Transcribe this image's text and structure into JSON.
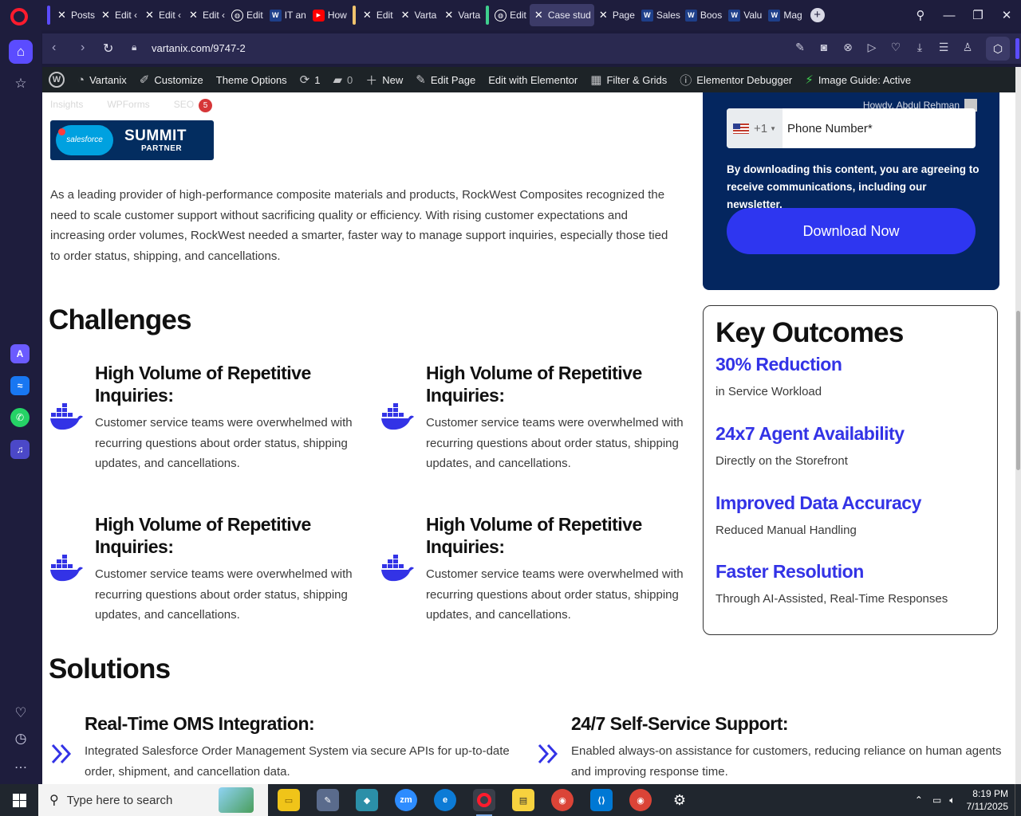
{
  "browser": {
    "tabs": [
      {
        "icon": "x-icon",
        "label": "Posts",
        "group_color": "#5b4cff"
      },
      {
        "icon": "x-icon",
        "label": "Edit ‹"
      },
      {
        "icon": "x-icon",
        "label": "Edit ‹"
      },
      {
        "icon": "x-icon",
        "label": "Edit ‹"
      },
      {
        "icon": "globe-icon",
        "label": "Edit"
      },
      {
        "icon": "wp-icon",
        "label": "IT an"
      },
      {
        "icon": "youtube-icon",
        "label": "How"
      },
      {
        "icon": "x-icon",
        "label": "Edit",
        "group_color": "#f0c36d"
      },
      {
        "icon": "x-icon",
        "label": "Varta"
      },
      {
        "icon": "x-icon",
        "label": "Varta"
      },
      {
        "icon": "globe-icon",
        "label": "Edit",
        "group_color": "#3fcf8e"
      },
      {
        "icon": "x-icon",
        "label": "Case stud",
        "active": true
      },
      {
        "icon": "x-icon",
        "label": "Page"
      },
      {
        "icon": "wp-icon",
        "label": "Sales"
      },
      {
        "icon": "wp-icon",
        "label": "Boos"
      },
      {
        "icon": "wp-icon",
        "label": "Valu"
      },
      {
        "icon": "wp-icon",
        "label": "Mag"
      }
    ],
    "url": "vartanix.com/9747-2"
  },
  "wp_admin_bar": {
    "site_name": "Vartanix",
    "customize": "Customize",
    "theme_options": "Theme Options",
    "updates_count": "1",
    "comments_count": "0",
    "new": "New",
    "edit_page": "Edit Page",
    "edit_elementor": "Edit with Elementor",
    "filter_grids": "Filter & Grids",
    "elementor_debugger": "Elementor Debugger",
    "image_guide": "Image Guide: Active",
    "insights": "Insights",
    "wpforms": "WPForms",
    "seo": "SEO",
    "seo_badge": "5",
    "howdy": "Howdy, Abdul Rehman"
  },
  "partner_badge": {
    "brand": "salesforce",
    "title": "SUMMIT",
    "subtitle": "PARTNER"
  },
  "intro_text": "As a leading provider of high-performance composite materials and products, RockWest Composites recognized the need to scale customer support without sacrificing quality or efficiency. With rising customer expectations and increasing order volumes, RockWest needed a smarter, faster way to manage support inquiries, especially those tied to order status, shipping, and cancellations.",
  "challenges": {
    "heading": "Challenges",
    "items": [
      {
        "title": "High Volume of Repetitive Inquiries:",
        "body": "Customer service teams were overwhelmed with recurring questions about order status, shipping updates, and cancellations."
      },
      {
        "title": "High Volume of Repetitive Inquiries:",
        "body": "Customer service teams were overwhelmed with recurring questions about order status, shipping updates, and cancellations."
      },
      {
        "title": "High Volume of Repetitive Inquiries:",
        "body": "Customer service teams were overwhelmed with recurring questions about order status, shipping updates, and cancellations."
      },
      {
        "title": "High Volume of Repetitive Inquiries:",
        "body": "Customer service teams were overwhelmed with recurring questions about order status, shipping updates, and cancellations."
      }
    ]
  },
  "solutions": {
    "heading": "Solutions",
    "items": [
      {
        "title": "Real-Time OMS Integration:",
        "body": "Integrated Salesforce Order Management System via secure APIs for up-to-date order, shipment, and cancellation data."
      },
      {
        "title": "24/7 Self-Service Support:",
        "body": "Enabled always-on assistance for customers, reducing reliance on human agents and improving response time."
      }
    ]
  },
  "form": {
    "country_code": "+1",
    "phone_placeholder": "Phone Number*",
    "consent": "By downloading this content, you are agreeing to receive communications, including our newsletter.",
    "download_label": "Download Now"
  },
  "key_outcomes": {
    "heading": "Key Outcomes",
    "items": [
      {
        "title": "30% Reduction",
        "subtitle": "in Service Workload"
      },
      {
        "title": "24x7 Agent Availability",
        "subtitle": "Directly on the Storefront"
      },
      {
        "title": "Improved Data Accuracy",
        "subtitle": "Reduced Manual Handling"
      },
      {
        "title": "Faster Resolution",
        "subtitle": "Through AI-Assisted, Real-Time Responses"
      }
    ]
  },
  "taskbar": {
    "search_placeholder": "Type here to search",
    "time": "8:19 PM",
    "date": "7/11/2025"
  },
  "colors": {
    "accent": "#3333e6",
    "form_bg": "#04265f",
    "button": "#2e36f0",
    "opera_red": "#ff1b2d",
    "sidebar_accent": "#5b4cff"
  }
}
